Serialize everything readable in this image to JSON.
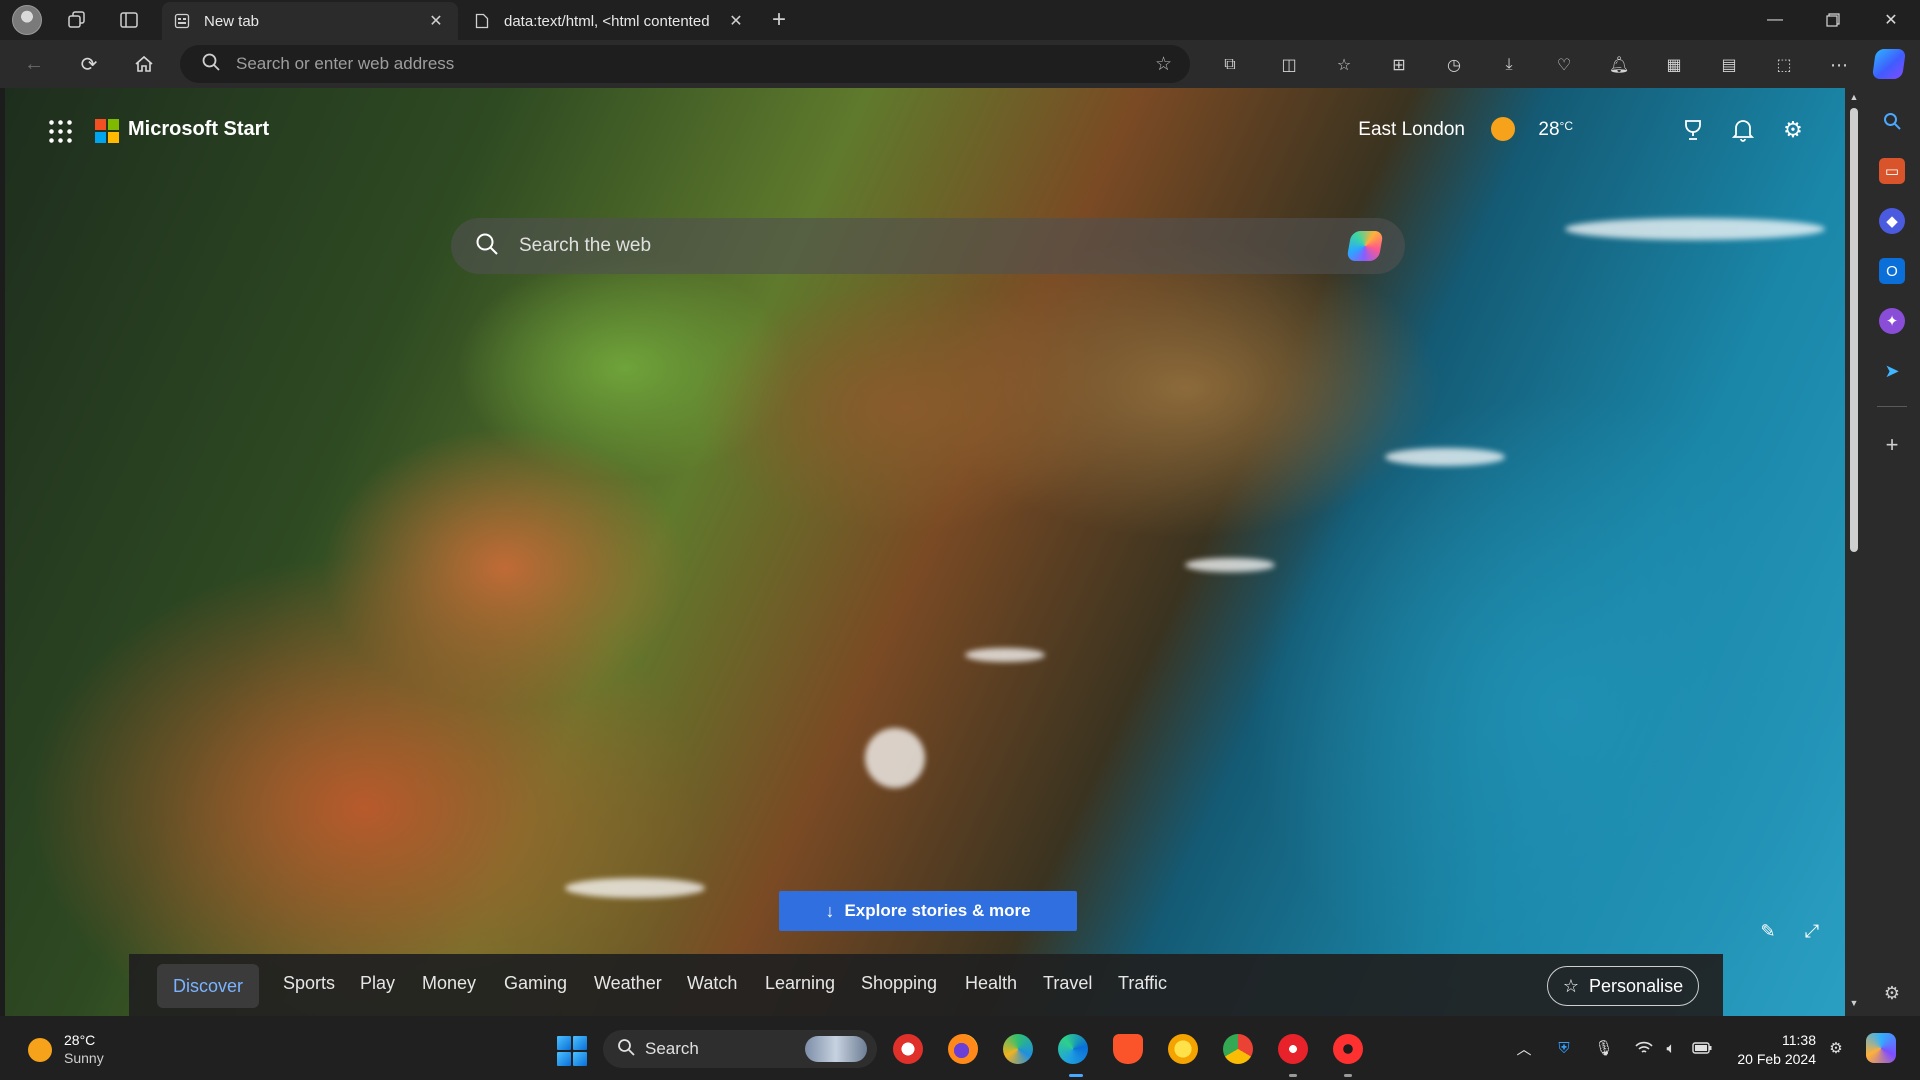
{
  "browser": {
    "tabs": [
      {
        "label": "New tab",
        "active": true
      },
      {
        "label": "data:text/html, <html contented"
      }
    ],
    "address": {
      "placeholder": "Search or enter web address"
    }
  },
  "ms_start": {
    "brand": "Microsoft Start",
    "logo_colors": [
      "#f25022",
      "#7fba00",
      "#00a4ef",
      "#ffb900"
    ],
    "weather": {
      "location": "East London",
      "temperature": "28",
      "unit": "°C"
    },
    "search_placeholder": "Search the web",
    "explore_label": "Explore stories & more",
    "categories": [
      "Discover",
      "Sports",
      "Play",
      "Money",
      "Gaming",
      "Weather",
      "Watch",
      "Learning",
      "Shopping",
      "Health",
      "Travel",
      "Traffic"
    ],
    "active_category": "Discover",
    "personalise_label": "Personalise"
  },
  "taskbar": {
    "weather_temp": "28°C",
    "weather_condition": "Sunny",
    "search_label": "Search",
    "time": "11:38",
    "date": "20 Feb 2024"
  },
  "colors": {
    "accent": "#2f6fe0",
    "active_tab_text": "#7ab3ff",
    "sun": "#f6a21b"
  }
}
